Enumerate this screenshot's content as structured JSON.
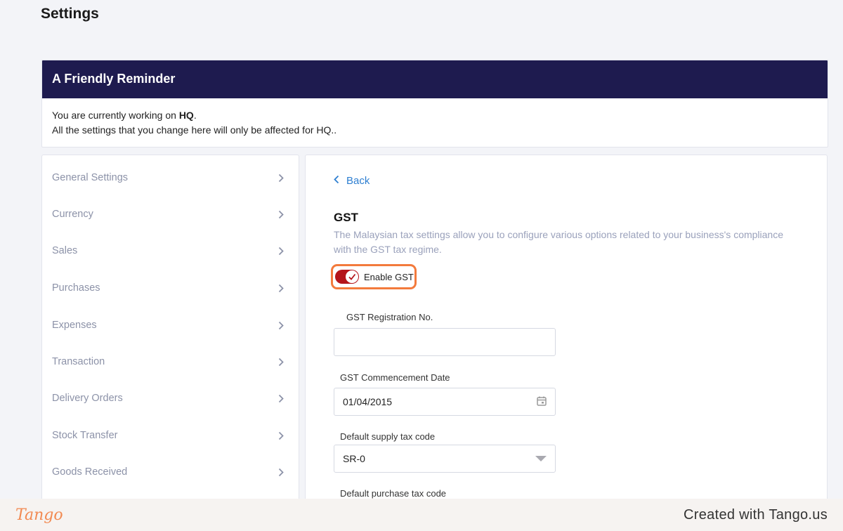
{
  "page": {
    "title": "Settings"
  },
  "reminder": {
    "heading": "A Friendly Reminder",
    "line1_prefix": "You are currently working on ",
    "line1_branch": "HQ",
    "line1_suffix": ".",
    "line2": "All the settings that you change here will only be affected for HQ.."
  },
  "sidebar": {
    "items": [
      {
        "label": "General Settings"
      },
      {
        "label": "Currency"
      },
      {
        "label": "Sales"
      },
      {
        "label": "Purchases"
      },
      {
        "label": "Expenses"
      },
      {
        "label": "Transaction"
      },
      {
        "label": "Delivery Orders"
      },
      {
        "label": "Stock Transfer"
      },
      {
        "label": "Goods Received"
      }
    ]
  },
  "main": {
    "back_label": "Back",
    "section_title": "GST",
    "section_desc": "The Malaysian tax settings allow you to configure various options related to your business's compliance with the GST tax regime.",
    "toggle": {
      "label": "Enable GST",
      "enabled": true
    },
    "fields": {
      "registration_no": {
        "label": "GST Registration No.",
        "value": ""
      },
      "commencement_date": {
        "label": "GST Commencement Date",
        "value": "01/04/2015"
      },
      "supply_tax_code": {
        "label": "Default supply tax code",
        "value": "SR-0"
      },
      "purchase_tax_code": {
        "label": "Default purchase tax code"
      }
    }
  },
  "colors": {
    "reminder_header": "#1e1b4f",
    "toggle_on": "#b4151b",
    "highlight": "#f37a3c",
    "link": "#2e7fd1"
  },
  "footer": {
    "logo": "Tango",
    "credit": "Created with Tango.us"
  }
}
